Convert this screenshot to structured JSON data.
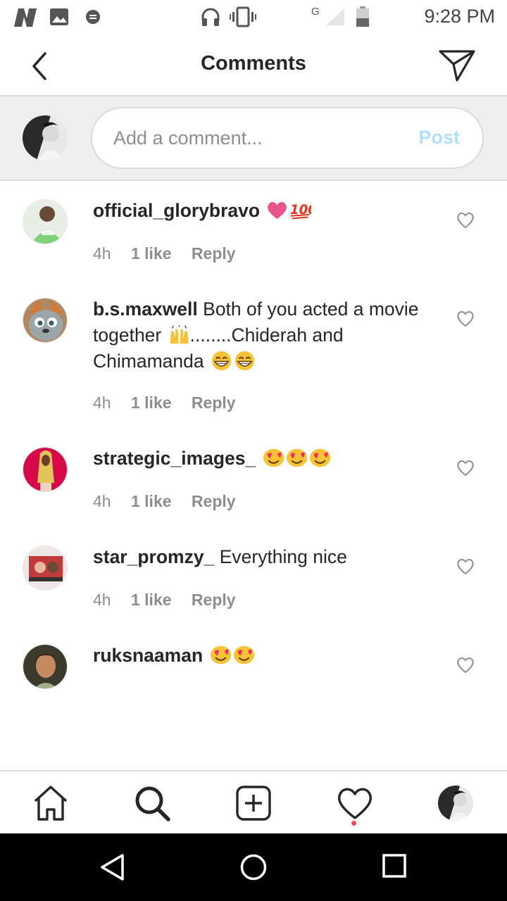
{
  "status_bar": {
    "time": "9:28 PM",
    "network_label": "G",
    "icons": [
      "n-notification-icon",
      "gallery-icon",
      "message-icon",
      "headset-icon",
      "vibrate-icon",
      "signal-icon",
      "battery-icon"
    ]
  },
  "header": {
    "title": "Comments",
    "back_icon": "chevron-left-icon",
    "send_icon": "paper-plane-icon"
  },
  "composer": {
    "placeholder": "Add a comment...",
    "value": "",
    "post_label": "Post"
  },
  "comments": [
    {
      "username": "official_glorybravo",
      "text": "",
      "emoji": [
        "pink-heart",
        "hundred-points"
      ],
      "time": "4h",
      "likes": "1 like",
      "reply": "Reply"
    },
    {
      "username": "b.s.maxwell",
      "text_1": "Both of you acted a movie together",
      "text_2": "........Chiderah and Chimamanda",
      "emoji_mid": [
        "raising-hands"
      ],
      "emoji_end": [
        "grinning-face",
        "grinning-face"
      ],
      "time": "4h",
      "likes": "1 like",
      "reply": "Reply"
    },
    {
      "username": "strategic_images_",
      "text": "",
      "emoji": [
        "heart-eyes",
        "heart-eyes",
        "heart-eyes"
      ],
      "time": "4h",
      "likes": "1 like",
      "reply": "Reply"
    },
    {
      "username": "star_promzy_",
      "text": "Everything nice",
      "time": "4h",
      "likes": "1 like",
      "reply": "Reply"
    },
    {
      "username": "ruksnaaman",
      "text": "",
      "emoji": [
        "heart-eyes",
        "heart-eyes"
      ]
    }
  ],
  "bottom_nav": [
    "home-icon",
    "search-icon",
    "new-post-icon",
    "activity-heart-icon",
    "profile-avatar"
  ],
  "system_nav": [
    "back-triangle-icon",
    "home-circle-icon",
    "recents-square-icon"
  ],
  "colors": {
    "accent_post_disabled": "#b2dffc",
    "notification_dot": "#ed4956",
    "meta_text": "#8e8e8e"
  }
}
